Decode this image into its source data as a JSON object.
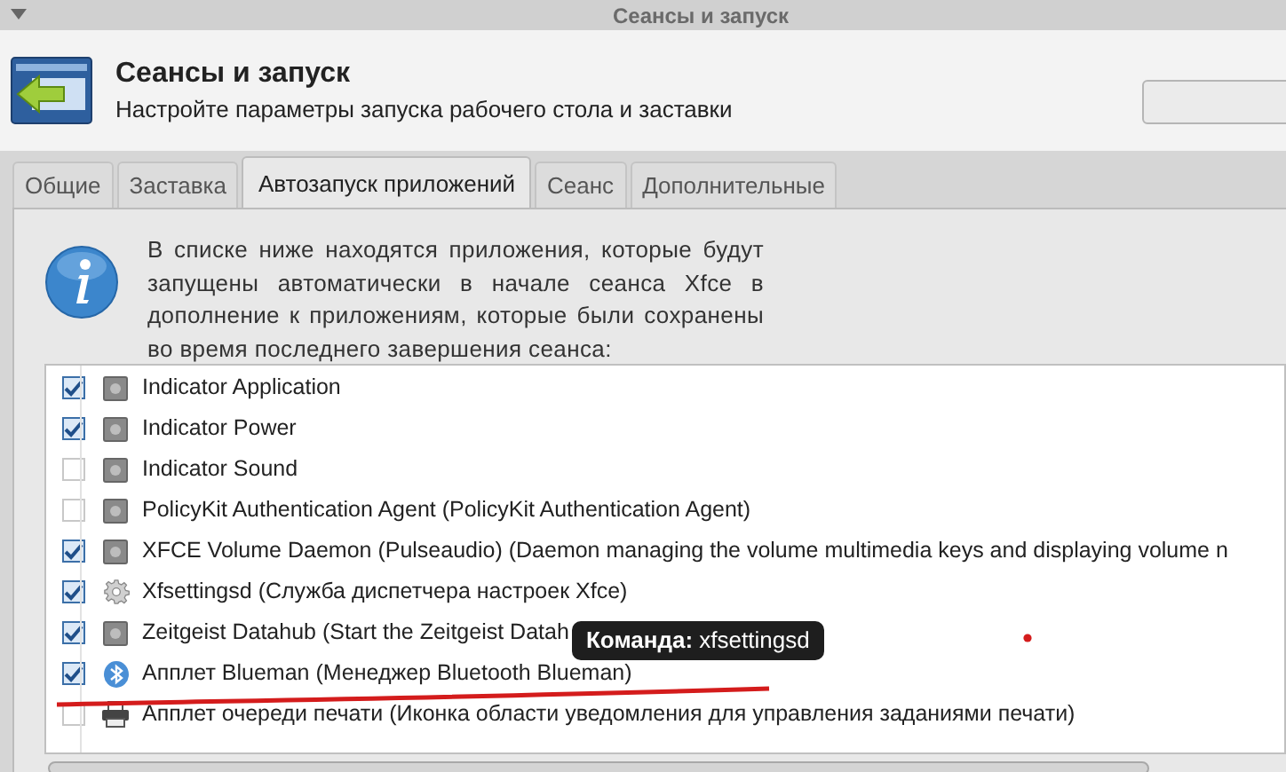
{
  "window": {
    "title": "Сеансы и запуск"
  },
  "header": {
    "title": "Сеансы и запуск",
    "subtitle": "Настройте параметры запуска рабочего стола и заставки"
  },
  "tabs": [
    {
      "label": "Общие",
      "selected": false
    },
    {
      "label": "Заставка",
      "selected": false
    },
    {
      "label": "Автозапуск приложений",
      "selected": true
    },
    {
      "label": "Сеанс",
      "selected": false
    },
    {
      "label": "Дополнительные",
      "selected": false
    }
  ],
  "info_text": "В списке ниже находятся приложения, которые будут запущены автоматически в начале сеанса Xfce в дополнение к приложениям, которые были сохранены во время последнего завершения сеанса:",
  "apps": [
    {
      "name": "Indicator Application",
      "checked": true,
      "kind": "generic"
    },
    {
      "name": "Indicator Power",
      "checked": true,
      "kind": "generic"
    },
    {
      "name": "Indicator Sound",
      "checked": false,
      "kind": "generic"
    },
    {
      "name": "PolicyKit Authentication Agent (PolicyKit Authentication Agent)",
      "checked": false,
      "kind": "generic"
    },
    {
      "name": "XFCE Volume Daemon (Pulseaudio) (Daemon managing the volume multimedia keys and displaying volume n",
      "checked": true,
      "kind": "generic"
    },
    {
      "name": "Xfsettingsd (Служба диспетчера настроек Xfce)",
      "checked": true,
      "kind": "gear"
    },
    {
      "name": "Zeitgeist Datahub (Start the Zeitgeist Datah",
      "checked": true,
      "kind": "generic"
    },
    {
      "name": "Апплет Blueman (Менеджер Bluetooth Blueman)",
      "checked": true,
      "kind": "bluetooth"
    },
    {
      "name": "Апплет очереди печати (Иконка области уведомления для управления заданиями печати)",
      "checked": false,
      "kind": "printer"
    }
  ],
  "tooltip": "**Команда:** xfsettingsd"
}
